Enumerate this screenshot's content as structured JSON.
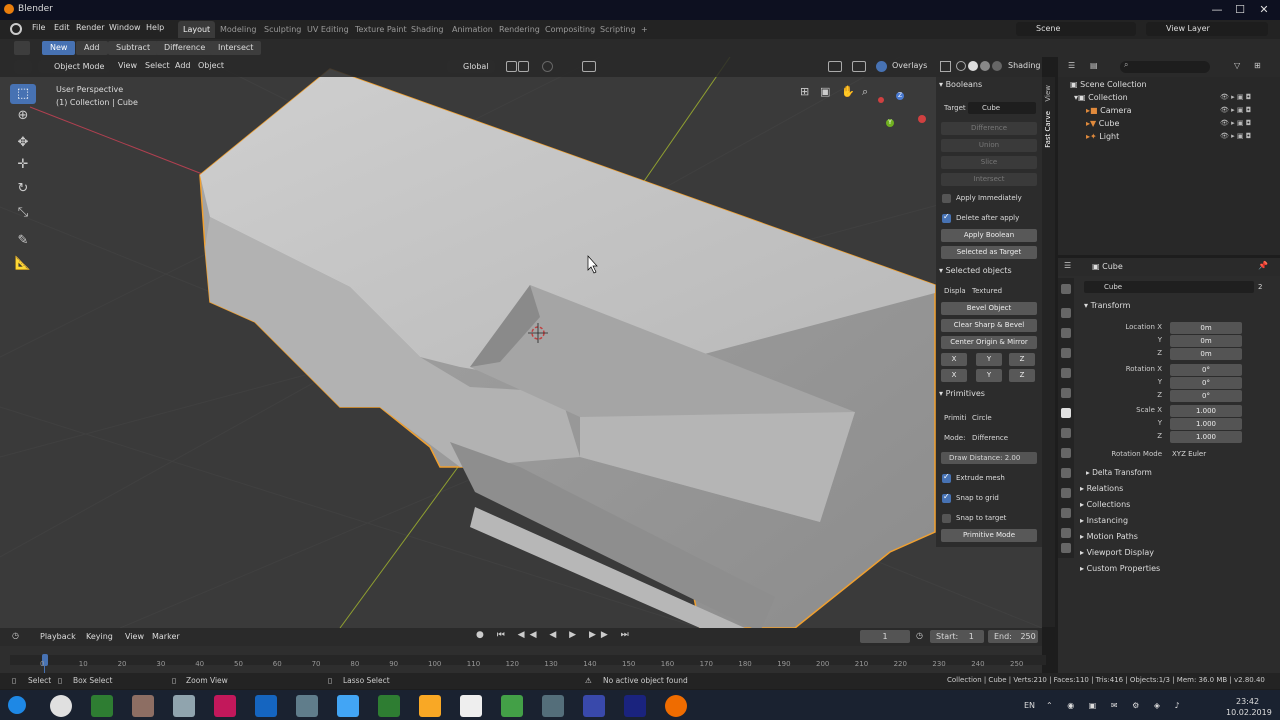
{
  "window": {
    "title": "Blender",
    "minimize": "—",
    "maximize": "☐",
    "close": "✕"
  },
  "topmenu": [
    "File",
    "Edit",
    "Render",
    "Window",
    "Help"
  ],
  "workspaces": [
    "Layout",
    "Modeling",
    "Sculpting",
    "UV Editing",
    "Texture Paint",
    "Shading",
    "Animation",
    "Rendering",
    "Compositing",
    "Scripting",
    "+"
  ],
  "scene": "Scene",
  "view_layer": "View Layer",
  "toolrow": {
    "new": "New",
    "add": "Add",
    "subtract": "Subtract",
    "difference": "Difference",
    "intersect": "Intersect"
  },
  "viewport_header": {
    "mode": "Object Mode",
    "view": "View",
    "select": "Select",
    "add": "Add",
    "object": "Object",
    "orientation": "Global",
    "overlays": "Overlays",
    "shading": "Shading"
  },
  "viewport_info": {
    "line1": "User Perspective",
    "line2": "(1) Collection | Cube"
  },
  "gizmo": {
    "z": "Z",
    "y": "Y",
    "x": "X"
  },
  "npanel": {
    "booleans_title": "Booleans",
    "target_label": "Target",
    "target_value": "Cube",
    "bool_buttons": [
      "Difference",
      "Union",
      "Slice",
      "Intersect"
    ],
    "apply_immediately": "Apply Immediately",
    "delete_after_apply": "Delete after apply",
    "apply_boolean": "Apply Boolean",
    "selected_as_target": "Selected as Target",
    "selected_objects_title": "Selected objects",
    "display_label": "Displa",
    "display_value": "Textured",
    "bevel_object": "Bevel Object",
    "clear_sharp_bevel": "Clear Sharp & Bevel",
    "center_origin_mirror": "Center Origin & Mirror",
    "axes": [
      "X",
      "Y",
      "Z",
      "X",
      "Y",
      "Z"
    ],
    "primitives_title": "Primitives",
    "primitive_label": "Primiti",
    "primitive_value": "Circle",
    "mode_label": "Mode:",
    "mode_value": "Difference",
    "draw_distance": "Draw Distance:",
    "draw_distance_value": "2.00",
    "extrude_mesh": "Extrude mesh",
    "snap_to_grid": "Snap to grid",
    "snap_to_target": "Snap to target",
    "primitive_mode": "Primitive Mode"
  },
  "vtabs": [
    "View",
    "Fast Carve"
  ],
  "outliner": {
    "scene_collection": "Scene Collection",
    "collection": "Collection",
    "items": [
      "Camera",
      "Cube",
      "Light"
    ]
  },
  "properties": {
    "object_name": "Cube",
    "data_name": "Cube",
    "users": "2",
    "transform_title": "Transform",
    "location": {
      "label_x": "Location X",
      "x": "0m",
      "y": "0m",
      "z": "0m"
    },
    "rotation": {
      "label_x": "Rotation X",
      "x": "0°",
      "y": "0°",
      "z": "0°"
    },
    "scale": {
      "label_x": "Scale X",
      "x": "1.000",
      "y": "1.000",
      "z": "1.000"
    },
    "axis_y": "Y",
    "axis_z": "Z",
    "rotation_mode_label": "Rotation Mode",
    "rotation_mode_value": "XYZ Euler",
    "sections": [
      "Delta Transform",
      "Relations",
      "Collections",
      "Instancing",
      "Motion Paths",
      "Viewport Display",
      "Custom Properties"
    ]
  },
  "timeline": {
    "playback": "Playback",
    "keying": "Keying",
    "view": "View",
    "marker": "Marker",
    "current": "1",
    "start_label": "Start:",
    "start": "1",
    "end_label": "End:",
    "end": "250",
    "ticks": [
      "0",
      "10",
      "20",
      "30",
      "40",
      "50",
      "60",
      "70",
      "80",
      "90",
      "100",
      "110",
      "120",
      "130",
      "140",
      "150",
      "160",
      "170",
      "180",
      "190",
      "200",
      "210",
      "220",
      "230",
      "240",
      "250"
    ]
  },
  "status": {
    "select": "Select",
    "box_select": "Box Select",
    "zoom_view": "Zoom View",
    "lasso_select": "Lasso Select",
    "message": "No active object found",
    "stats": "Collection | Cube | Verts:210 | Faces:110 | Tris:416 | Objects:1/3 | Mem: 36.0 MB | v2.80.40"
  },
  "taskbar": {
    "lang": "EN",
    "time": "23:42",
    "date": "10.02.2019"
  },
  "colors": {
    "accent": "#4772b3",
    "selection_outline": "#f0a030",
    "bg": "#3a3a3a"
  }
}
